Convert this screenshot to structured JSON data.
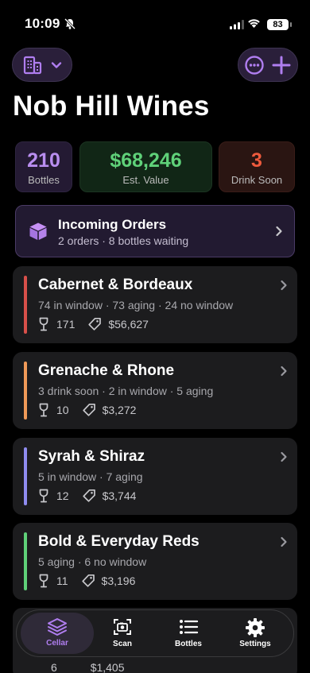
{
  "status": {
    "time": "10:09",
    "battery": "83"
  },
  "header": {
    "title": "Nob Hill Wines"
  },
  "stats": [
    {
      "value": "210",
      "label": "Bottles"
    },
    {
      "value": "$68,246",
      "label": "Est. Value"
    },
    {
      "value": "3",
      "label": "Drink Soon"
    }
  ],
  "orders": {
    "title": "Incoming Orders",
    "subtitle": "2 orders · 8 bottles waiting"
  },
  "categories": [
    {
      "name": "Cabernet & Bordeaux",
      "summary": "74 in window · 73 aging · 24 no window",
      "bottles": "171",
      "value": "$56,627",
      "color": "#d8504a"
    },
    {
      "name": "Grenache & Rhone",
      "summary": "3 drink soon · 2 in window · 5 aging",
      "bottles": "10",
      "value": "$3,272",
      "color": "#f09a58"
    },
    {
      "name": "Syrah & Shiraz",
      "summary": "5 in window · 7 aging",
      "bottles": "12",
      "value": "$3,744",
      "color": "#8f8cf0"
    },
    {
      "name": "Bold & Everyday Reds",
      "summary": "5 aging · 6 no window",
      "bottles": "11",
      "value": "$3,196",
      "color": "#5fd179"
    }
  ],
  "partial": {
    "bottles": "6",
    "value": "$1,405"
  },
  "tabs": [
    {
      "label": "Cellar",
      "icon": "layers-icon",
      "active": true
    },
    {
      "label": "Scan",
      "icon": "camera-scan-icon"
    },
    {
      "label": "Bottles",
      "icon": "list-icon"
    },
    {
      "label": "Settings",
      "icon": "gear-icon"
    }
  ],
  "colors": {
    "accent": "#b07ef0",
    "green": "#5fd179",
    "red": "#ee5a3d"
  }
}
